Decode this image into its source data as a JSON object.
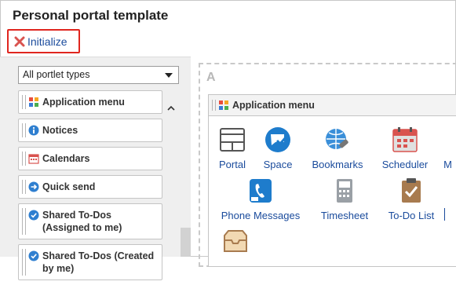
{
  "page": {
    "title": "Personal portal template"
  },
  "toolbar": {
    "initialize_label": "Initialize"
  },
  "left_panel": {
    "select_value": "All portlet types",
    "items": [
      {
        "label": "Application menu"
      },
      {
        "label": "Notices"
      },
      {
        "label": "Calendars"
      },
      {
        "label": "Quick send"
      },
      {
        "label": "Shared To-Dos (Assigned to me)"
      },
      {
        "label": "Shared To-Dos (Created by me)"
      }
    ]
  },
  "layout_area": {
    "label": "A"
  },
  "portlet": {
    "title": "Application menu",
    "apps": [
      {
        "label": "Portal",
        "icon": "portal-icon"
      },
      {
        "label": "Space",
        "icon": "space-icon"
      },
      {
        "label": "Bookmarks",
        "icon": "bookmarks-icon"
      },
      {
        "label": "Scheduler",
        "icon": "scheduler-icon"
      },
      {
        "label": "M",
        "icon": "mail-icon"
      },
      {
        "label": "Phone Messages",
        "icon": "phone-messages-icon"
      },
      {
        "label": "Timesheet",
        "icon": "timesheet-icon"
      },
      {
        "label": "To-Do List",
        "icon": "todo-list-icon"
      },
      {
        "label": "",
        "icon": "inbox-icon"
      }
    ]
  },
  "colors": {
    "accent_red": "#e0261f",
    "link_blue": "#1a4b9c",
    "icon_blue": "#1e7ccc",
    "panel_gray": "#efefef"
  }
}
